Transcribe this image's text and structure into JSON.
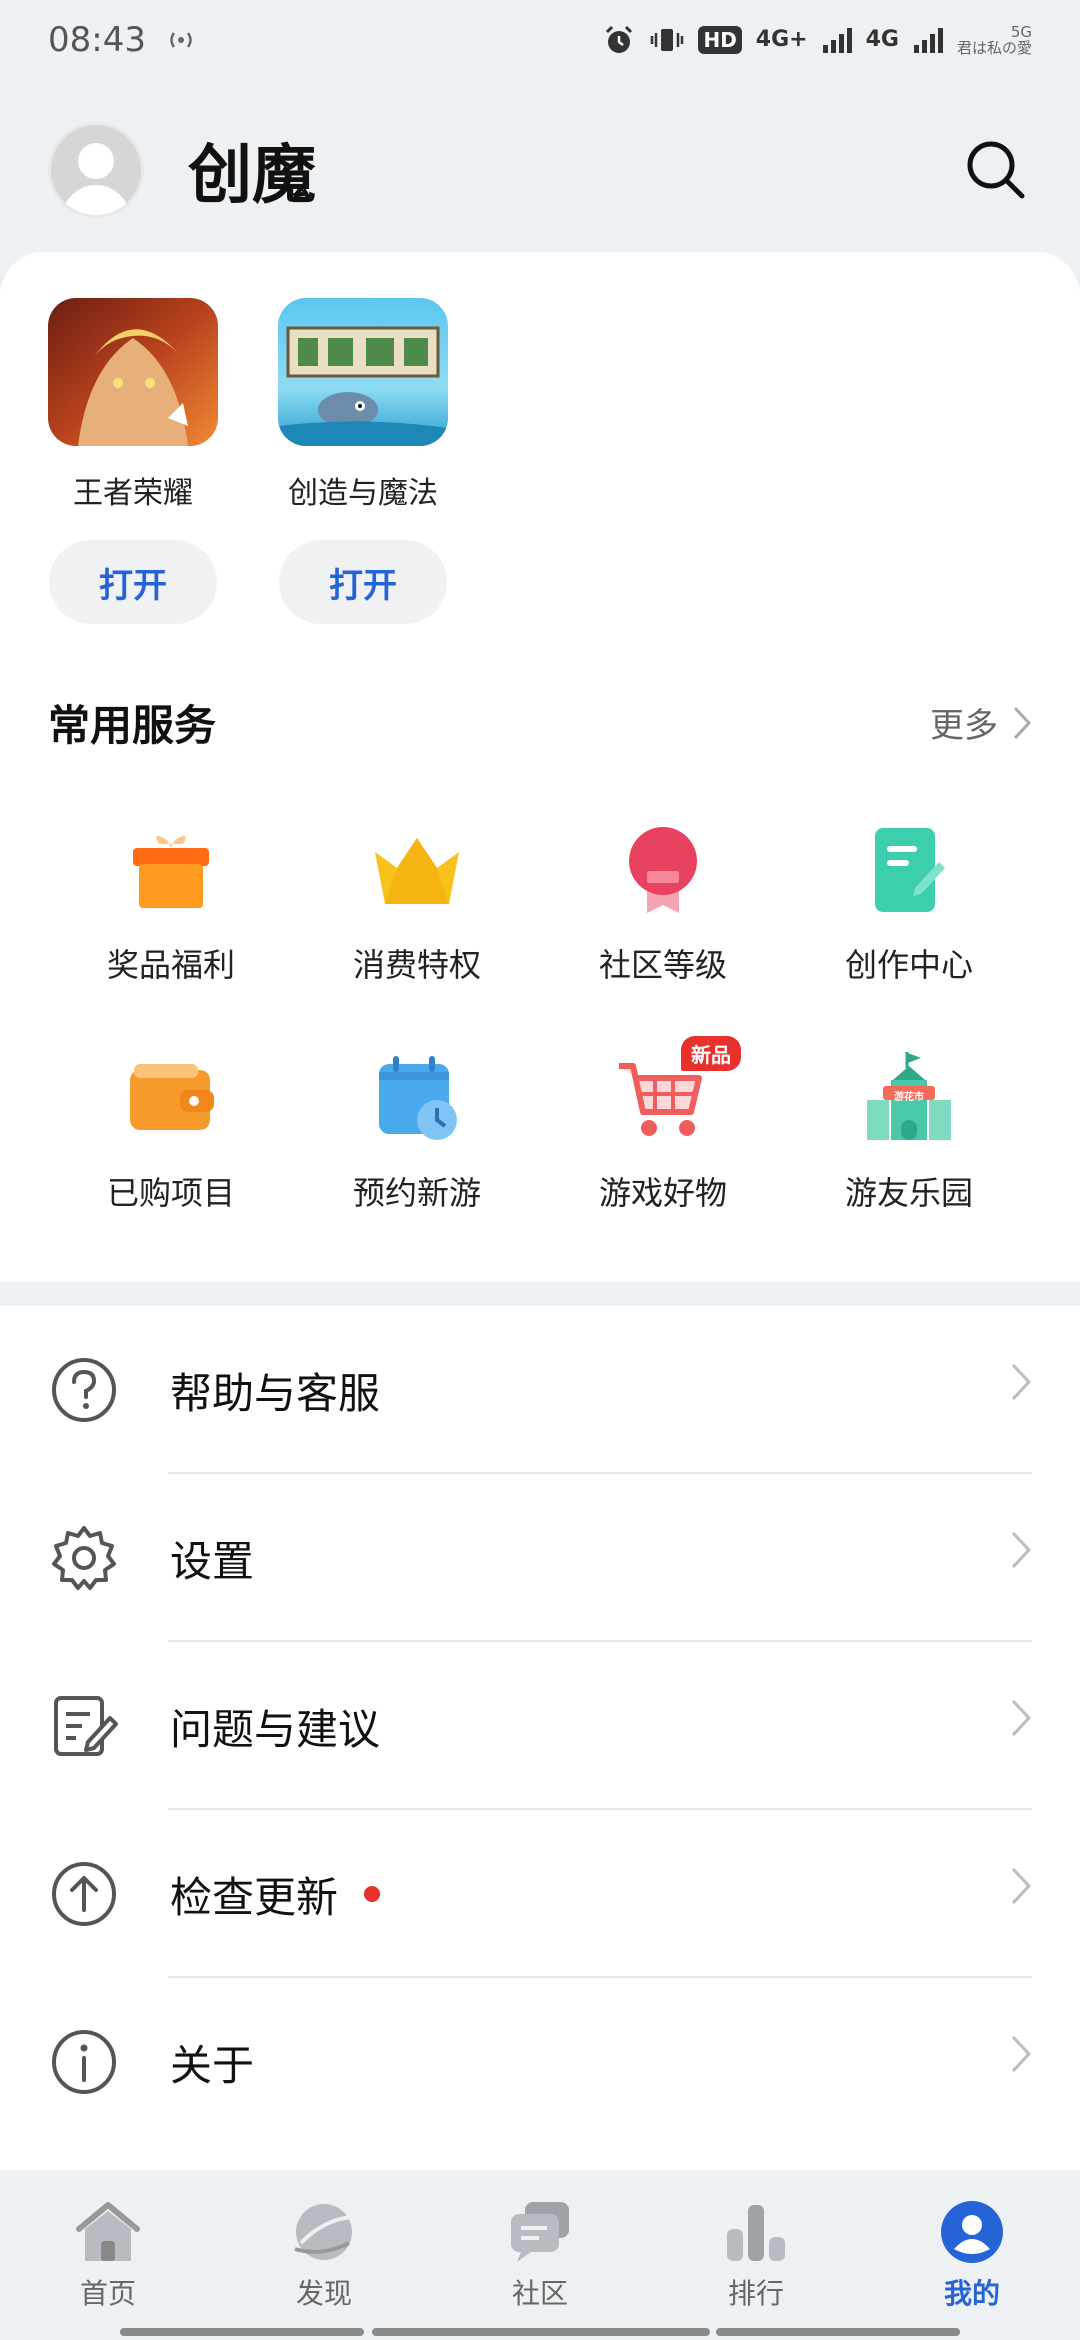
{
  "status_bar": {
    "time": "08:43",
    "hd_badge": "HD",
    "network_1": "4G+",
    "network_2": "4G",
    "carrier_line1": "5G",
    "carrier_line2": "君は私の愛"
  },
  "header": {
    "username": "创魔"
  },
  "games": [
    {
      "name": "王者荣耀",
      "button": "打开",
      "icon": "honor-of-kings-icon"
    },
    {
      "name": "创造与魔法",
      "button": "打开",
      "icon": "create-and-magic-icon"
    }
  ],
  "services_section": {
    "title": "常用服务",
    "more": "更多",
    "items": [
      {
        "label": "奖品福利",
        "icon": "gift-icon",
        "color": "#ff9a1f"
      },
      {
        "label": "消费特权",
        "icon": "crown-icon",
        "color": "#f7c21a"
      },
      {
        "label": "社区等级",
        "icon": "medal-icon",
        "color": "#e8425e"
      },
      {
        "label": "创作中心",
        "icon": "edit-document-icon",
        "color": "#3dcfad"
      },
      {
        "label": "已购项目",
        "icon": "wallet-icon",
        "color": "#f79a2c"
      },
      {
        "label": "预约新游",
        "icon": "calendar-clock-icon",
        "color": "#4aa8ec"
      },
      {
        "label": "游戏好物",
        "icon": "shopping-cart-icon",
        "color": "#f05d5d",
        "badge": "新品"
      },
      {
        "label": "游友乐园",
        "icon": "castle-icon",
        "color": "#49c9a8",
        "sign": "游花市"
      }
    ]
  },
  "menu": [
    {
      "label": "帮助与客服",
      "icon": "help-icon"
    },
    {
      "label": "设置",
      "icon": "settings-icon"
    },
    {
      "label": "问题与建议",
      "icon": "feedback-icon"
    },
    {
      "label": "检查更新",
      "icon": "update-icon",
      "has_dot": true
    },
    {
      "label": "关于",
      "icon": "info-icon"
    }
  ],
  "tabbar": [
    {
      "label": "首页",
      "icon": "home-icon",
      "active": false
    },
    {
      "label": "发现",
      "icon": "discover-icon",
      "active": false
    },
    {
      "label": "社区",
      "icon": "community-icon",
      "active": false
    },
    {
      "label": "排行",
      "icon": "ranking-icon",
      "active": false
    },
    {
      "label": "我的",
      "icon": "profile-icon",
      "active": true
    }
  ],
  "colors": {
    "accent": "#2564d6",
    "background": "#eef1f4",
    "red_dot": "#e8312d"
  }
}
